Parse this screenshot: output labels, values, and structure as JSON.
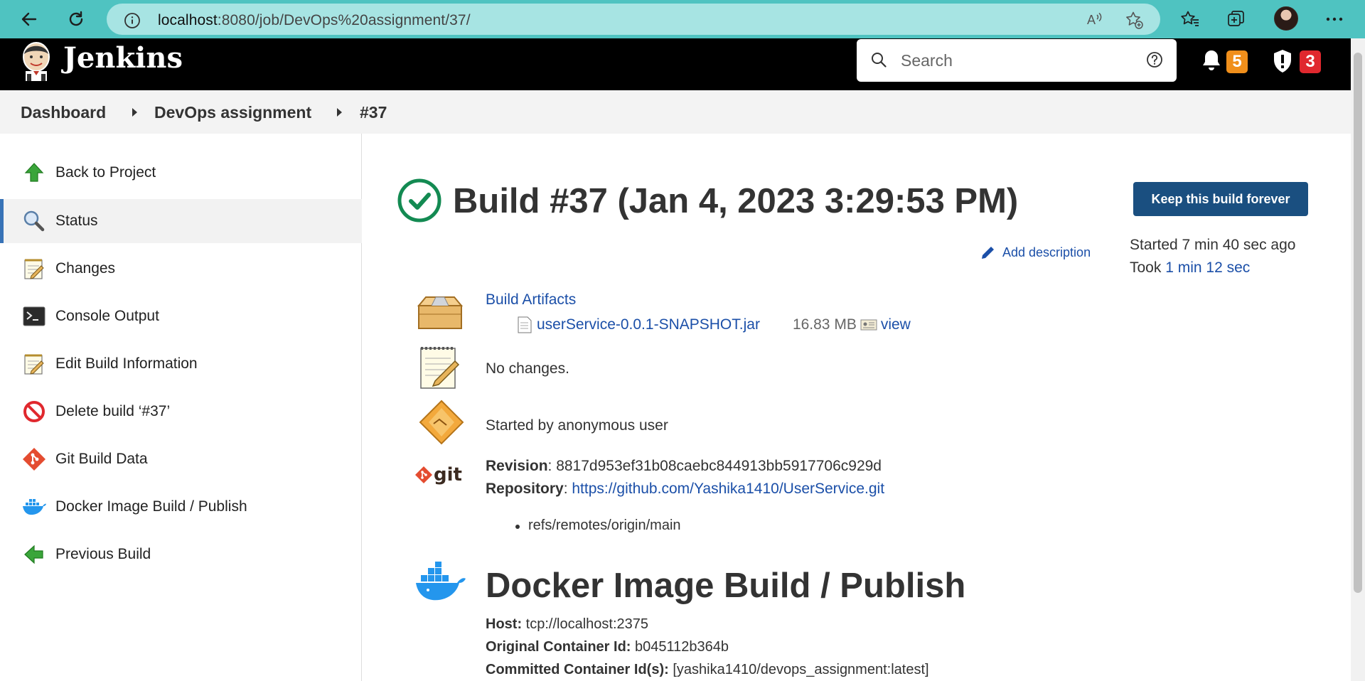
{
  "browser": {
    "url_host": "localhost",
    "url_rest": ":8080/job/DevOps%20assignment/37/"
  },
  "header": {
    "brand": "Jenkins",
    "search_placeholder": "Search",
    "notifications_count": "5",
    "security_count": "3",
    "colors": {
      "notifications": "#f08f1b",
      "security": "#e0282e"
    }
  },
  "breadcrumb": {
    "items": [
      "Dashboard",
      "DevOps assignment",
      "#37"
    ]
  },
  "sidebar": {
    "items": [
      {
        "label": "Back to Project",
        "icon": "arrow-up-icon"
      },
      {
        "label": "Status",
        "icon": "magnifier-icon"
      },
      {
        "label": "Changes",
        "icon": "notepad-icon"
      },
      {
        "label": "Console Output",
        "icon": "terminal-icon"
      },
      {
        "label": "Edit Build Information",
        "icon": "notepad-icon"
      },
      {
        "label": "Delete build ‘#37’",
        "icon": "no-entry-icon"
      },
      {
        "label": "Git Build Data",
        "icon": "git-icon"
      },
      {
        "label": "Docker Image Build / Publish",
        "icon": "docker-icon"
      },
      {
        "label": "Previous Build",
        "icon": "arrow-left-icon"
      }
    ]
  },
  "main": {
    "title": "Build #37 (Jan 4, 2023 3:29:53 PM)",
    "keep_button": "Keep this build forever",
    "add_description": "Add description",
    "started_ago": "Started 7 min 40 sec ago",
    "took_label": "Took",
    "took_value": "1 min 12 sec",
    "artifacts_heading": "Build Artifacts",
    "artifact_name": "userService-0.0.1-SNAPSHOT.jar",
    "artifact_size": "16.83 MB",
    "artifact_view": "view",
    "no_changes": "No changes.",
    "started_by": "Started by anonymous user",
    "revision_label": "Revision",
    "revision_value": ": 8817d953ef31b08caebc844913bb5917706c929d",
    "repository_label": "Repository",
    "repository_sep": ": ",
    "repository_url": "https://github.com/Yashika1410/UserService.git",
    "branch": "refs/remotes/origin/main",
    "docker_title": "Docker Image Build / Publish",
    "host_label": "Host:",
    "host_value": " tcp://localhost:2375",
    "orig_container_label": "Original Container Id:",
    "orig_container_value": " b045112b364b",
    "committed_label": "Committed Container Id(s):",
    "committed_value": " [yashika1410/devops_assignment:latest]"
  }
}
